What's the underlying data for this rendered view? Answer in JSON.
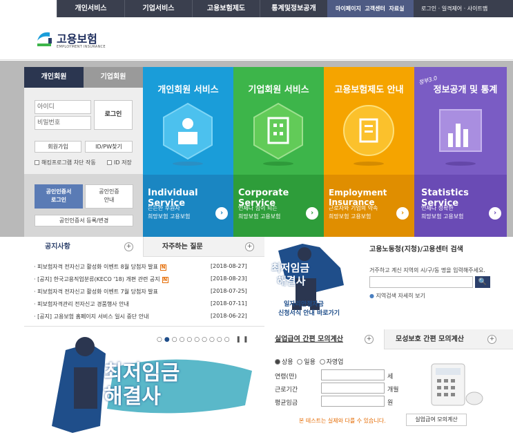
{
  "topnav": {
    "items": [
      "개인서비스",
      "기업서비스",
      "고용보험제도",
      "통계및정보공개"
    ],
    "links": [
      "마이페이지",
      "고객센터",
      "자료실"
    ],
    "utils": "로그인 · 일격제어 · 사이트맵"
  },
  "logo": {
    "title": "고용보험",
    "sub": "EMPLOYMENT INSURANCE"
  },
  "login": {
    "tabs": [
      "개인회원",
      "기업회원"
    ],
    "id_ph": "아이디",
    "pw_ph": "비밀번호",
    "login": "로그인",
    "join": "회원가입",
    "find": "ID/PW찾기",
    "hack": "해킹프로그램 차단 작동",
    "save": "ID 저장",
    "cert_login": "공인인증서\n로그인",
    "cert_guide": "공인인증\n안내",
    "cert_reg": "공인인증서 등록/변경"
  },
  "tiles": [
    {
      "title": "개인회원 서비스",
      "en": "Individual Service",
      "desc1": "든든한 후원자",
      "desc2": "희망보험 고용보험"
    },
    {
      "title": "기업회원 서비스",
      "en": "Corporate Service",
      "desc1": "언제나 힘이 되는",
      "desc2": "희망보험 고용보험"
    },
    {
      "title": "고용보험제도 안내",
      "en": "Employment Insurance",
      "desc1": "근로자와 기업의 약속",
      "desc2": "희망보험 고용보험"
    },
    {
      "title": "정보공개 및 통계",
      "badge": "정부3.0",
      "en": "Statistics Service",
      "desc1": "언제나 정확한",
      "desc2": "희망보험 고용보험"
    }
  ],
  "notice": {
    "tab1": "공지사항",
    "tab2": "자주하는 질문",
    "items": [
      {
        "t": "피보험자격 전자신고 활성화 이벤트 8월 당첨자 발표",
        "d": "[2018-08-27]",
        "n": true
      },
      {
        "t": "[공지] 한국고용직업분류(KECO '18) 개편 관련 공지",
        "d": "[2018-08-23]",
        "n": true
      },
      {
        "t": "피보험자격 전자신고 활성화 이벤트 7월 당첨자 발표",
        "d": "[2018-07-25]",
        "n": false
      },
      {
        "t": "피보험자격관리 전자신고 경품행사 안내",
        "d": "[2018-07-11]",
        "n": false
      },
      {
        "t": "[공지] 고용보험 홈페이지 서비스 일시 중단 안내",
        "d": "[2018-06-22]",
        "n": false
      }
    ],
    "n_label": "N"
  },
  "promo": {
    "t1": "최저임금",
    "t2": "해결사",
    "s1": "일자리안정자금",
    "s2": "신청서식 안내 바로가기"
  },
  "search": {
    "title": "고용노동청(지청)/고용센터 검색",
    "desc": "거주하고 계신 지역의 시/구/동 명을 입력해주세요.",
    "btn": "🔍",
    "link": "지역검색 자세히 보기"
  },
  "banner": {
    "t1": "최저임금",
    "t2": "해결사"
  },
  "calc": {
    "tab1": "실업급여 간편 모의계산",
    "tab2": "모성보호 간편 모의계산",
    "radios": [
      "상용",
      "일용",
      "자영업"
    ],
    "age": "연령(만)",
    "age_u": "세",
    "period": "근로기간",
    "period_u": "개월",
    "wage": "평균임금",
    "wage_u": "원",
    "note": "본 테스트는 실제와 다를 수 있습니다.",
    "btn": "실업급여 모의계산"
  },
  "colors": {
    "blue": "#1a9dd9",
    "green": "#3db54a",
    "orange": "#f5a400",
    "purple": "#7a5cc4",
    "navy": "#2b3f6a"
  }
}
